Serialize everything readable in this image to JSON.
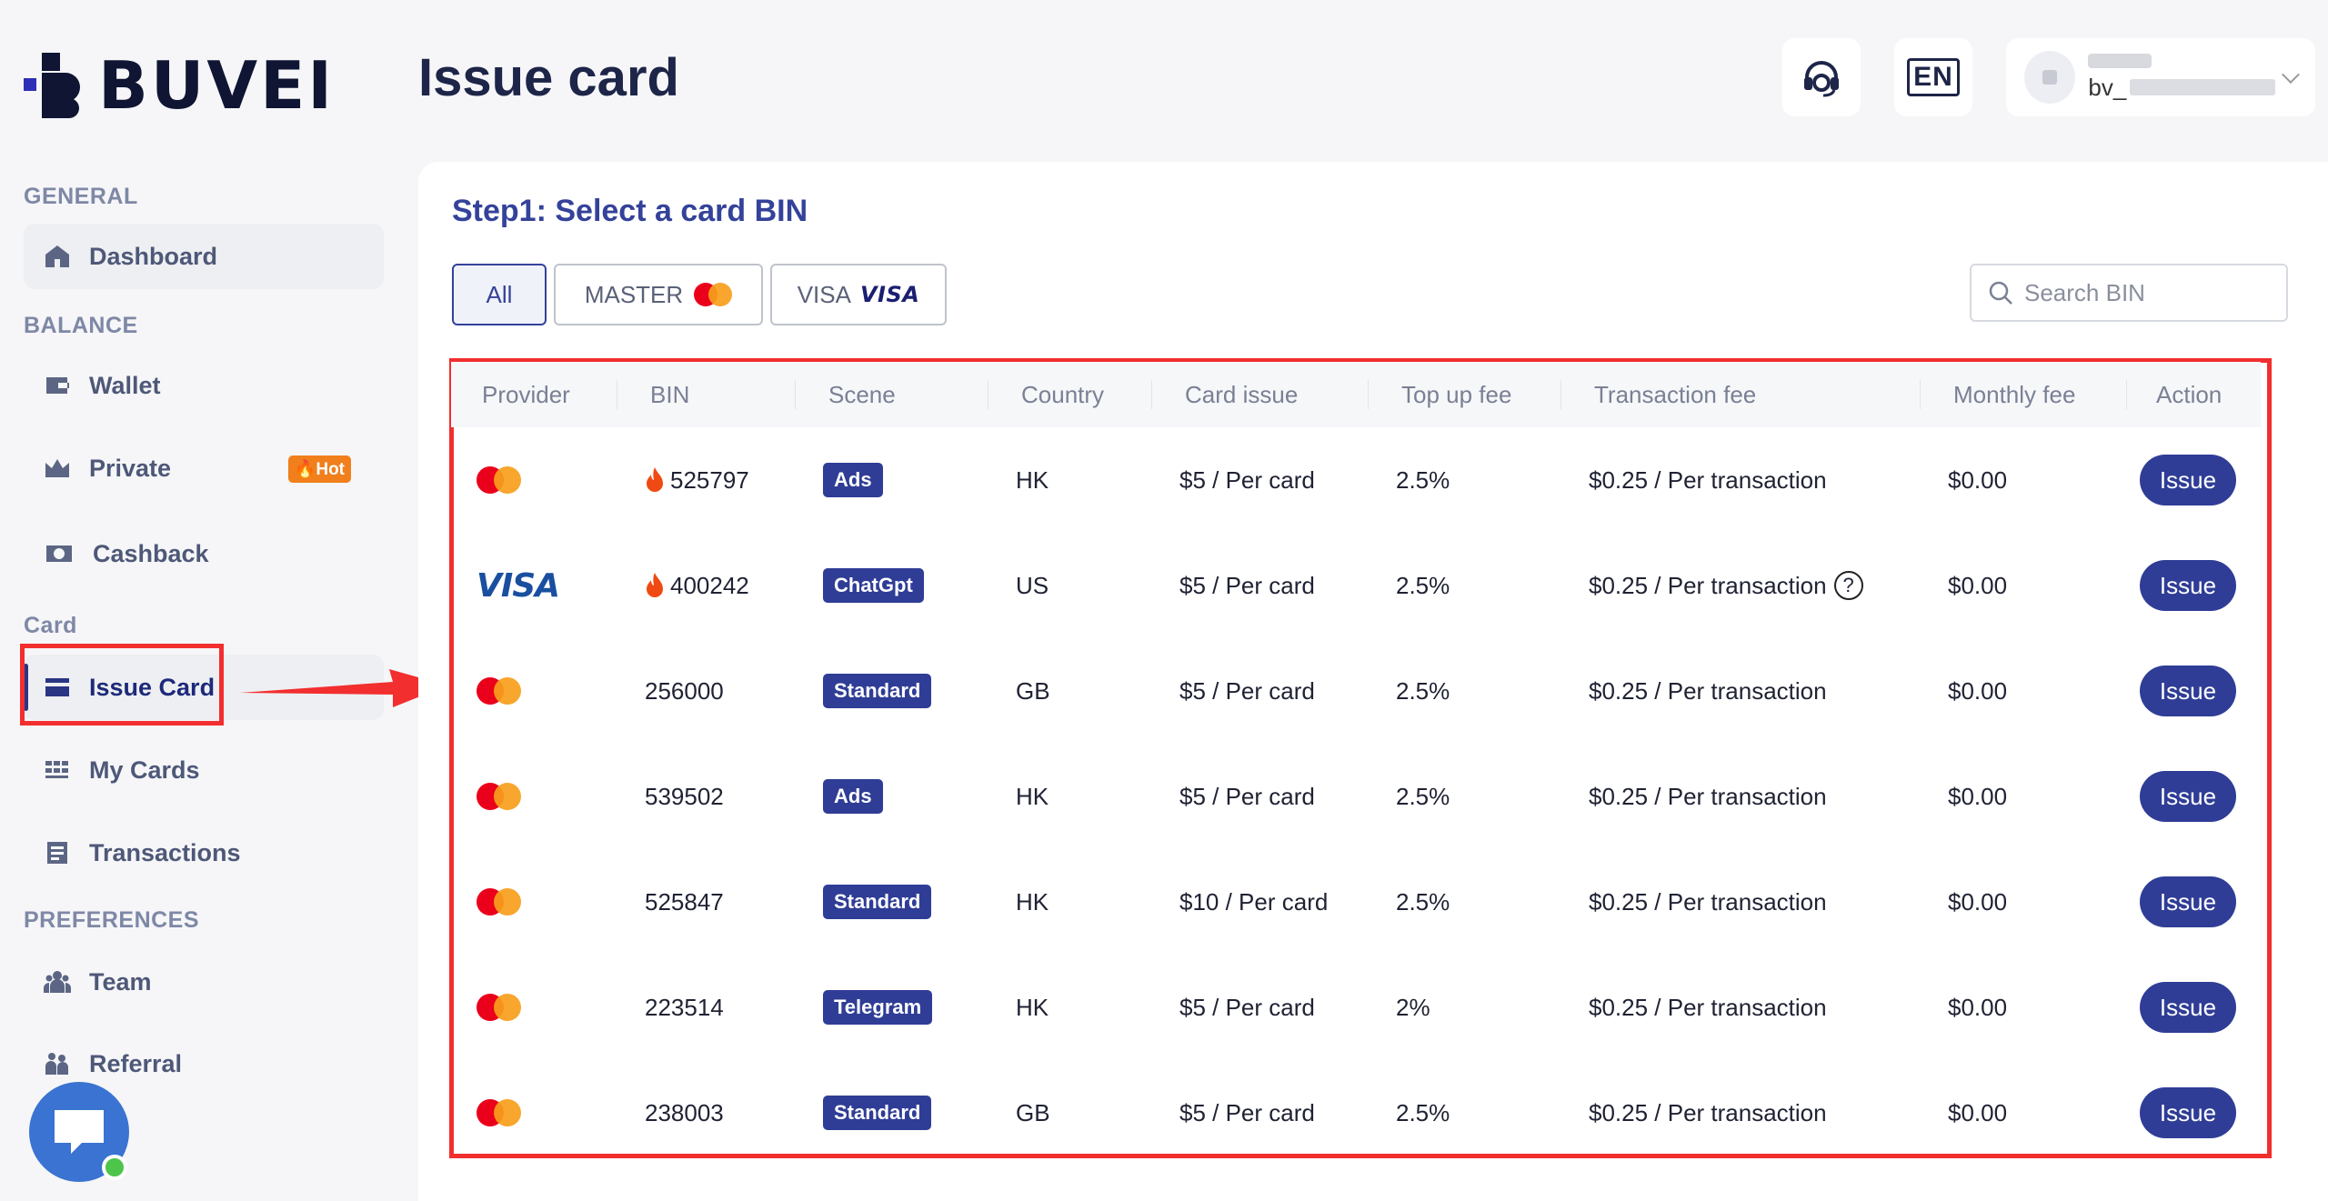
{
  "app": {
    "logo_text": "BUVEI",
    "page_title": "Issue card"
  },
  "header": {
    "lang_label": "EN",
    "user_prefix": "bv_"
  },
  "sidebar": {
    "sections": {
      "general": "GENERAL",
      "balance": "BALANCE",
      "card": "Card",
      "preferences": "PREFERENCES"
    },
    "items": {
      "dashboard": "Dashboard",
      "wallet": "Wallet",
      "private": "Private",
      "private_badge": "Hot",
      "cashback": "Cashback",
      "issue_card": "Issue Card",
      "my_cards": "My Cards",
      "transactions": "Transactions",
      "team": "Team",
      "referral": "Referral"
    }
  },
  "main": {
    "step_title": "Step1: Select a card BIN",
    "filters": {
      "all": "All",
      "master": "MASTER",
      "visa": "VISA",
      "visa_logo": "VISA"
    },
    "search_placeholder": "Search BIN",
    "columns": [
      "Provider",
      "BIN",
      "Scene",
      "Country",
      "Card issue",
      "Top up fee",
      "Transaction fee",
      "Monthly fee",
      "Action"
    ],
    "rows": [
      {
        "provider": "mastercard",
        "hot": true,
        "bin": "525797",
        "scene": "Ads",
        "country": "HK",
        "card_issue": "$5 / Per card",
        "top_up_fee": "2.5%",
        "transaction_fee": "$0.25 / Per transaction",
        "help": false,
        "monthly_fee": "$0.00",
        "action": "Issue"
      },
      {
        "provider": "visa",
        "hot": true,
        "bin": "400242",
        "scene": "ChatGpt",
        "country": "US",
        "card_issue": "$5 / Per card",
        "top_up_fee": "2.5%",
        "transaction_fee": "$0.25 / Per transaction",
        "help": true,
        "monthly_fee": "$0.00",
        "action": "Issue"
      },
      {
        "provider": "mastercard",
        "hot": false,
        "bin": "256000",
        "scene": "Standard",
        "country": "GB",
        "card_issue": "$5 / Per card",
        "top_up_fee": "2.5%",
        "transaction_fee": "$0.25 / Per transaction",
        "help": false,
        "monthly_fee": "$0.00",
        "action": "Issue"
      },
      {
        "provider": "mastercard",
        "hot": false,
        "bin": "539502",
        "scene": "Ads",
        "country": "HK",
        "card_issue": "$5 / Per card",
        "top_up_fee": "2.5%",
        "transaction_fee": "$0.25 / Per transaction",
        "help": false,
        "monthly_fee": "$0.00",
        "action": "Issue"
      },
      {
        "provider": "mastercard",
        "hot": false,
        "bin": "525847",
        "scene": "Standard",
        "country": "HK",
        "card_issue": "$10 / Per card",
        "top_up_fee": "2.5%",
        "transaction_fee": "$0.25 / Per transaction",
        "help": false,
        "monthly_fee": "$0.00",
        "action": "Issue"
      },
      {
        "provider": "mastercard",
        "hot": false,
        "bin": "223514",
        "scene": "Telegram",
        "country": "HK",
        "card_issue": "$5 / Per card",
        "top_up_fee": "2%",
        "transaction_fee": "$0.25 / Per transaction",
        "help": false,
        "monthly_fee": "$0.00",
        "action": "Issue"
      },
      {
        "provider": "mastercard",
        "hot": false,
        "bin": "238003",
        "scene": "Standard",
        "country": "GB",
        "card_issue": "$5 / Per card",
        "top_up_fee": "2.5%",
        "transaction_fee": "$0.25 / Per transaction",
        "help": false,
        "monthly_fee": "$0.00",
        "action": "Issue"
      }
    ],
    "help_glyph": "?"
  },
  "colors": {
    "brand": "#2f3d96",
    "accent_red": "#f22e2e",
    "hot_orange": "#f07f1c",
    "chat_blue": "#3a73d1"
  }
}
